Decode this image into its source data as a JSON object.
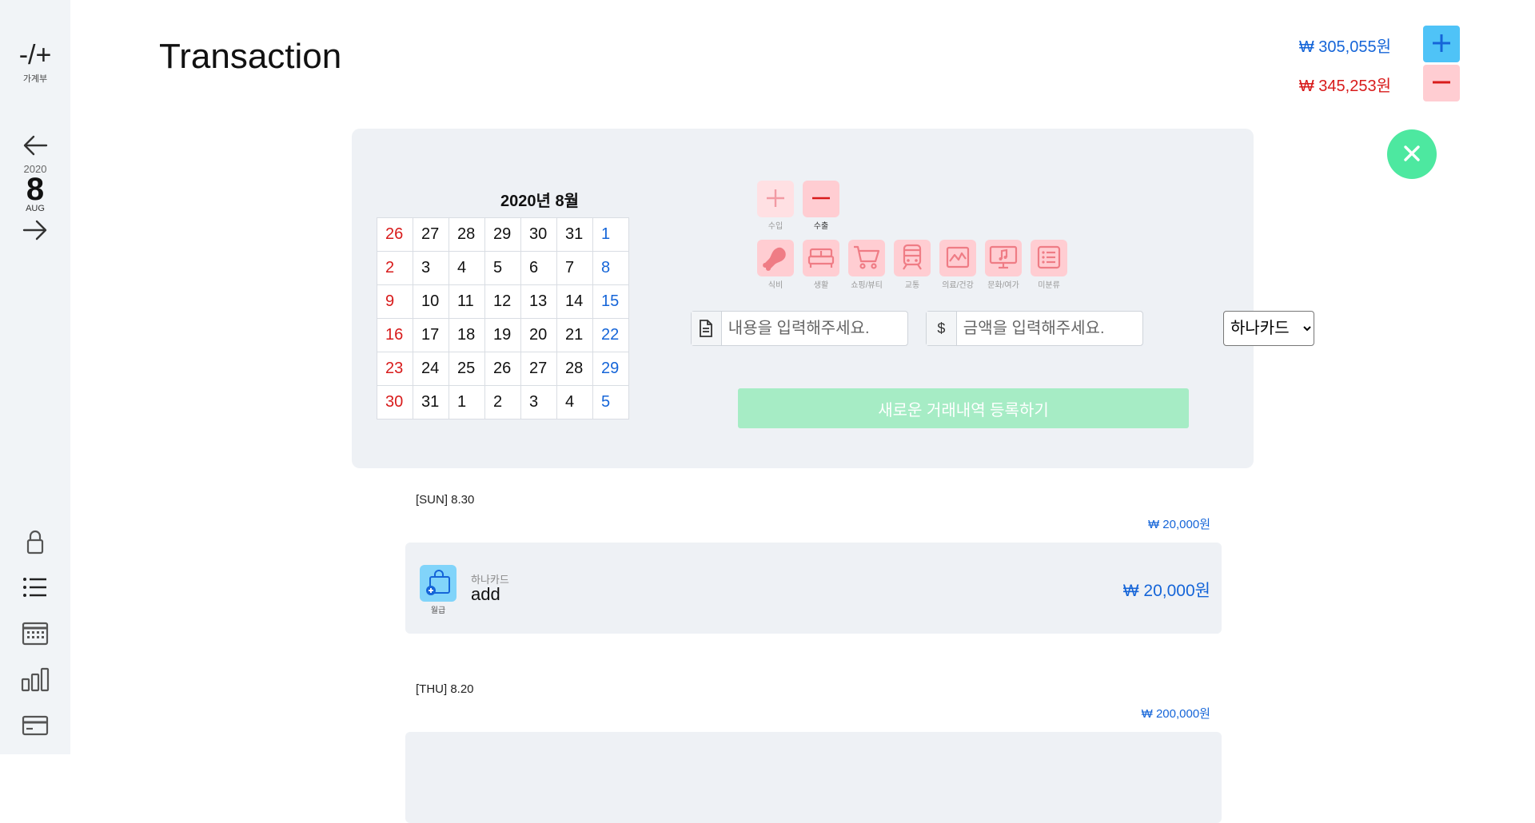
{
  "sidebar": {
    "logo_mark": "-/+",
    "logo_label": "가계부",
    "year": "2020",
    "day": "8",
    "month": "AUG"
  },
  "header": {
    "title": "Transaction",
    "income_total": "₩ 305,055원",
    "expense_total": "₩ 345,253원"
  },
  "calendar": {
    "title": "2020년 8월",
    "weeks": [
      [
        "26",
        "27",
        "28",
        "29",
        "30",
        "31",
        "1"
      ],
      [
        "2",
        "3",
        "4",
        "5",
        "6",
        "7",
        "8"
      ],
      [
        "9",
        "10",
        "11",
        "12",
        "13",
        "14",
        "15"
      ],
      [
        "16",
        "17",
        "18",
        "19",
        "20",
        "21",
        "22"
      ],
      [
        "23",
        "24",
        "25",
        "26",
        "27",
        "28",
        "29"
      ],
      [
        "30",
        "31",
        "1",
        "2",
        "3",
        "4",
        "5"
      ]
    ]
  },
  "form": {
    "type_income": "수입",
    "type_expense": "수출",
    "categories": [
      "식비",
      "생활",
      "쇼핑/뷰티",
      "교통",
      "의료/건강",
      "문화/여가",
      "미분류"
    ],
    "content_placeholder": "내용을 입력해주세요.",
    "currency_symbol": "$",
    "amount_placeholder": "금액을 입력해주세요.",
    "payment_selected": "하나카드",
    "submit_label": "새로운 거래내역 등록하기"
  },
  "days": [
    {
      "date": "[SUN] 8.30",
      "total": "₩ 20,000원",
      "items": [
        {
          "category": "월급",
          "card": "하나카드",
          "content": "add",
          "amount": "₩ 20,000원"
        }
      ]
    },
    {
      "date": "[THU] 8.20",
      "total": "₩ 200,000원"
    }
  ],
  "colors": {
    "income": "#1565d8",
    "expense": "#d81b1b",
    "accent_green": "#4de8a0",
    "panel_bg": "#eef1f5"
  }
}
